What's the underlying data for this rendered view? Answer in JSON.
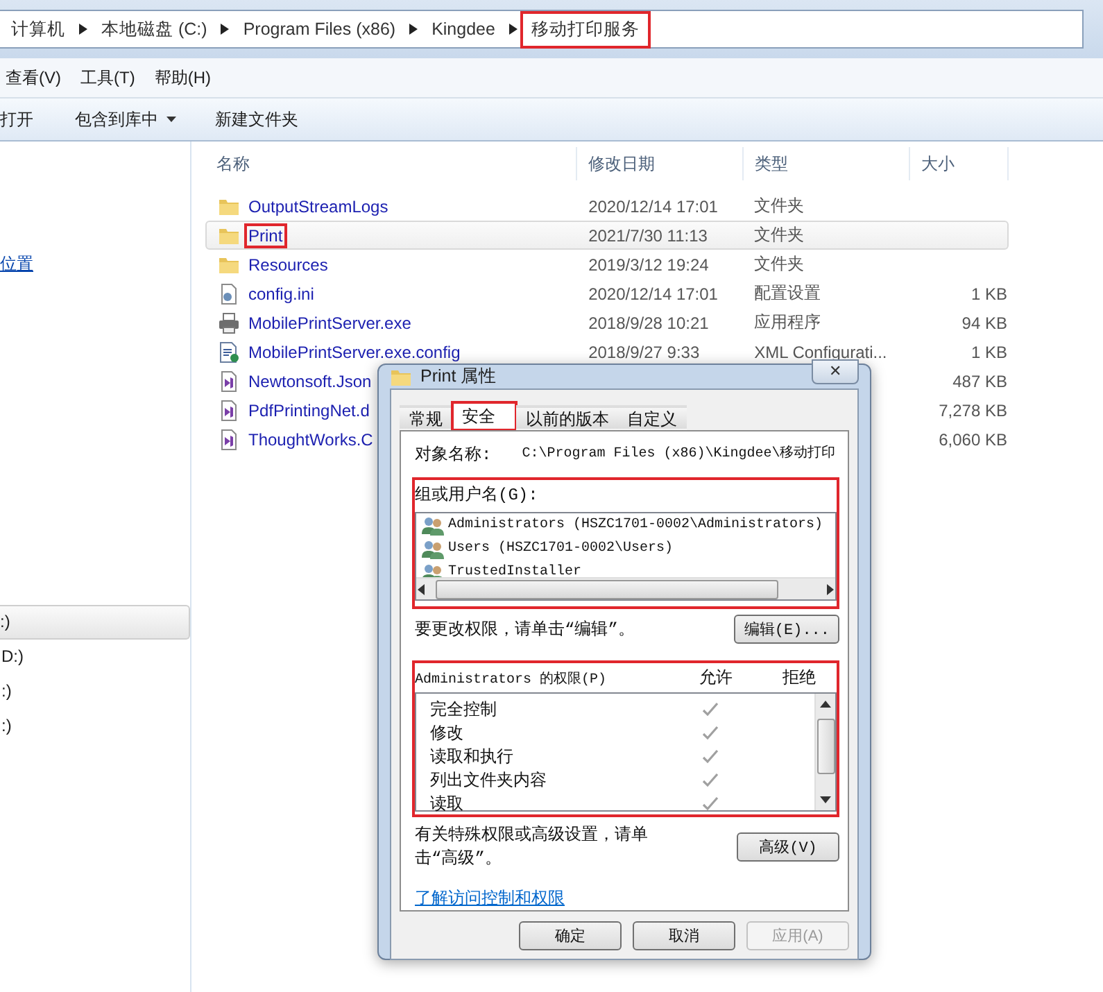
{
  "address_bar": {
    "crumbs": [
      {
        "label": "计算机",
        "highlighted": false
      },
      {
        "label": "本地磁盘 (C:)",
        "highlighted": false
      },
      {
        "label": "Program Files (x86)",
        "highlighted": false
      },
      {
        "label": "Kingdee",
        "highlighted": false
      },
      {
        "label": "移动打印服务",
        "highlighted": true
      }
    ]
  },
  "menu_bar": [
    "查看(V)",
    "工具(T)",
    "帮助(H)"
  ],
  "toolbar": [
    {
      "label": "打开",
      "dropdown": false
    },
    {
      "label": "包含到库中",
      "dropdown": true
    },
    {
      "label": "新建文件夹",
      "dropdown": false
    }
  ],
  "sidebar": {
    "link": "位置",
    "drives": [
      {
        "label": ":)",
        "selected": true
      },
      {
        "label": "D:)",
        "selected": false
      },
      {
        "label": ":)",
        "selected": false
      },
      {
        "label": ":)",
        "selected": false
      }
    ]
  },
  "file_list": {
    "columns": [
      "名称",
      "修改日期",
      "类型",
      "大小"
    ],
    "rows": [
      {
        "kind": "folder",
        "name": "OutputStreamLogs",
        "date": "2020/12/14 17:01",
        "type": "文件夹",
        "size": "",
        "selected": false,
        "highlighted": false
      },
      {
        "kind": "folder",
        "name": "Print",
        "date": "2021/7/30 11:13",
        "type": "文件夹",
        "size": "",
        "selected": true,
        "highlighted": true
      },
      {
        "kind": "folder",
        "name": "Resources",
        "date": "2019/3/12 19:24",
        "type": "文件夹",
        "size": "",
        "selected": false,
        "highlighted": false
      },
      {
        "kind": "settings",
        "name": "config.ini",
        "date": "2020/12/14 17:01",
        "type": "配置设置",
        "size": "1 KB",
        "selected": false,
        "highlighted": false
      },
      {
        "kind": "printer",
        "name": "MobilePrintServer.exe",
        "date": "2018/9/28 10:21",
        "type": "应用程序",
        "size": "94 KB",
        "selected": false,
        "highlighted": false
      },
      {
        "kind": "config",
        "name": "MobilePrintServer.exe.config",
        "date": "2018/9/27 9:33",
        "type": "XML Configurati...",
        "size": "1 KB",
        "selected": false,
        "highlighted": false
      },
      {
        "kind": "library",
        "name": "Newtonsoft.Json",
        "date": "",
        "type": "",
        "size": "487 KB",
        "selected": false,
        "highlighted": false
      },
      {
        "kind": "library",
        "name": "PdfPrintingNet.d",
        "date": "",
        "type": "",
        "size": "7,278 KB",
        "selected": false,
        "highlighted": false
      },
      {
        "kind": "library",
        "name": "ThoughtWorks.C",
        "date": "",
        "type": "",
        "size": "6,060 KB",
        "selected": false,
        "highlighted": false
      }
    ]
  },
  "dialog": {
    "title": "Print 属性",
    "close": "✕",
    "tabs": [
      {
        "label": "常规",
        "selected": false,
        "highlighted": false
      },
      {
        "label": "安全",
        "selected": true,
        "highlighted": true
      },
      {
        "label": "以前的版本",
        "selected": false,
        "highlighted": false
      },
      {
        "label": "自定义",
        "selected": false,
        "highlighted": false
      }
    ],
    "object_label": "对象名称:",
    "object_value": "C:\\Program Files (x86)\\Kingdee\\移动打印",
    "group_label": "组或用户名(G):",
    "groups_highlighted": true,
    "groups": [
      {
        "name": "Administrators (HSZC1701-0002\\Administrators)",
        "selected": false
      },
      {
        "name": "Users (HSZC1701-0002\\Users)",
        "selected": false
      },
      {
        "name": "TrustedInstaller",
        "selected": false
      }
    ],
    "edit_hint": "要更改权限，请单击“编辑”。",
    "edit_button": "编辑(E)...",
    "permissions_highlighted": true,
    "permissions_label": "Administrators 的权限(P)",
    "allow_label": "允许",
    "deny_label": "拒绝",
    "permissions": [
      {
        "name": "完全控制",
        "allow": true,
        "deny": false
      },
      {
        "name": "修改",
        "allow": true,
        "deny": false
      },
      {
        "name": "读取和执行",
        "allow": true,
        "deny": false
      },
      {
        "name": "列出文件夹内容",
        "allow": true,
        "deny": false
      },
      {
        "name": "读取",
        "allow": true,
        "deny": false
      }
    ],
    "advanced_hint": "有关特殊权限或高级设置，请单击“高级”。",
    "advanced_button": "高级(V)",
    "learn_link": "了解访问控制和权限",
    "buttons": [
      {
        "label": "确定",
        "disabled": false
      },
      {
        "label": "取消",
        "disabled": false
      },
      {
        "label": "应用(A)",
        "disabled": true
      }
    ]
  }
}
